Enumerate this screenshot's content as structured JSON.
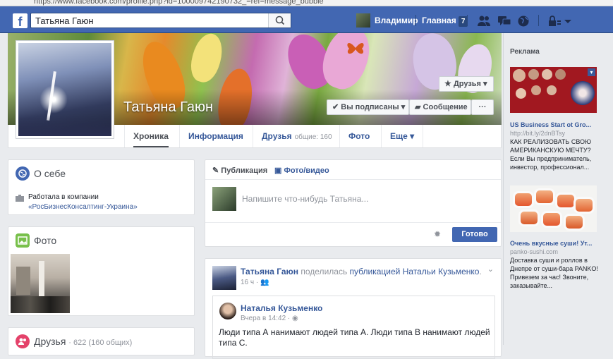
{
  "browser": {
    "url_text": "https://www.facebook.com/profile.php?id=100009742190732_=ref=message_bubble"
  },
  "topbar": {
    "logo": "f",
    "search_value": "Татьяна Гаюн",
    "user_name": "Владимир",
    "home_label": "Главная",
    "home_badge": "7",
    "icons": [
      "friends-icon",
      "messages-icon",
      "globe-icon",
      "lock-icon",
      "chevron-down-icon"
    ]
  },
  "profile": {
    "name": "Татьяна Гаюн",
    "friends_btn": "Друзья",
    "subscribed_btn": "Вы подписаны",
    "message_btn": "Сообщение",
    "more_btn": "···"
  },
  "tabs": [
    {
      "label": "Хроника"
    },
    {
      "label": "Информация"
    },
    {
      "label": "Друзья",
      "sub": "общие: 160"
    },
    {
      "label": "Фото"
    },
    {
      "label": "Еще"
    }
  ],
  "about": {
    "title": "О себе",
    "work_prefix": "Работала в компании",
    "work_company": "«РосБизнесКонсалтинг-Украина»"
  },
  "photos": {
    "title": "Фото"
  },
  "friends_card": {
    "title": "Друзья",
    "count": "· 622 (160 общих)"
  },
  "composer": {
    "tab_post": "Публикация",
    "tab_photo": "Фото/видео",
    "placeholder": "Напишите что-нибудь Татьяна...",
    "done_btn": "Готово"
  },
  "post": {
    "author": "Татьяна Гаюн",
    "action": "поделилась",
    "object": "публикацией Натальи Кузьменко",
    "time": "16 ч",
    "shared_author": "Наталья Кузьменко",
    "shared_time": "Вчера в 14:42",
    "text": "Люди типа А нанимают людей типа А. Люди типа В нанимают людей типа С."
  },
  "ads": {
    "header": "Реклама",
    "items": [
      {
        "title": "US Business Start ot Gro...",
        "url": "http://bit.ly/2dnBTsy",
        "text": "КАК РЕАЛИЗОВАТЬ СВОЮ АМЕРИКАНСКУЮ МЕЧТУ? Если Вы предприниматель, инвестор, профессионал..."
      },
      {
        "title": "Очень вкусные суши! Ут...",
        "url": "panko-sushi.com",
        "text": "Доставка суши и роллов в Днепре от суши-бара PANKO! Привезем за час! Звоните, заказывайте..."
      }
    ]
  }
}
